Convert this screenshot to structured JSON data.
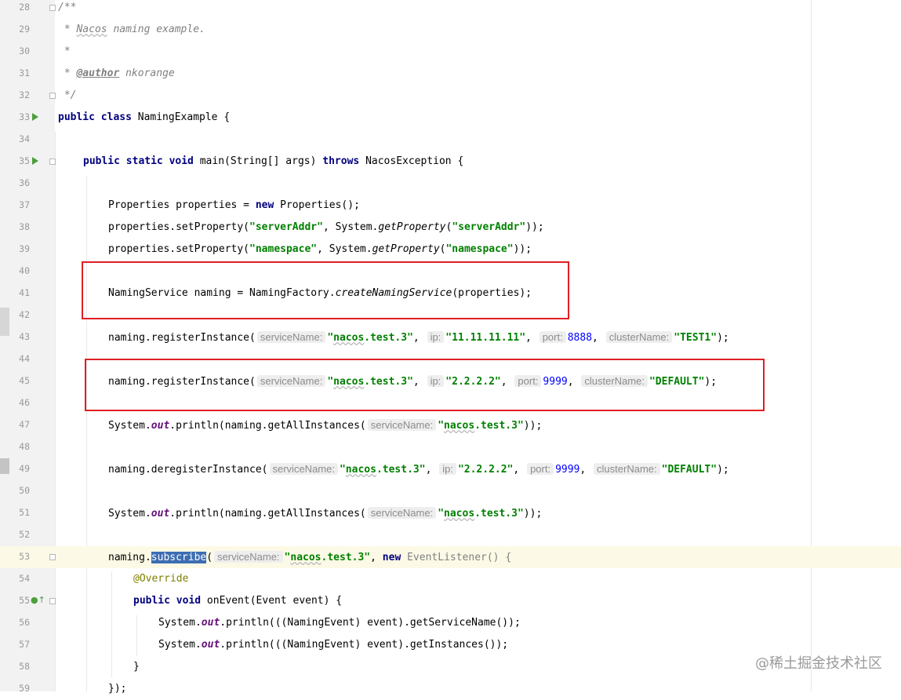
{
  "editor": {
    "lines": {
      "l28": {
        "ln": "28",
        "c": "/**"
      },
      "l29": {
        "ln": "29",
        "a": " * ",
        "b": "Nacos",
        "c": " naming example."
      },
      "l30": {
        "ln": "30",
        "c": " *"
      },
      "l31": {
        "ln": "31",
        "a": " * ",
        "b": "@author",
        "c": " nkorange"
      },
      "l32": {
        "ln": "32",
        "c": " */"
      },
      "l33": {
        "ln": "33",
        "a": "public class ",
        "b": "NamingExample {"
      },
      "l34": {
        "ln": "34"
      },
      "l35": {
        "ln": "35",
        "a": "public static void ",
        "b": "main(String[] args) ",
        "c": "throws ",
        "d": "NacosException {"
      },
      "l36": {
        "ln": "36"
      },
      "l37": {
        "ln": "37",
        "a": "Properties properties = ",
        "b": "new ",
        "c": "Properties();"
      },
      "l38": {
        "ln": "38",
        "a": "properties.setProperty(",
        "b": "\"serverAddr\"",
        "c": ", System.",
        "d": "getProperty",
        "e": "(",
        "f": "\"serverAddr\"",
        "g": "));"
      },
      "l39": {
        "ln": "39",
        "a": "properties.setProperty(",
        "b": "\"namespace\"",
        "c": ", System.",
        "d": "getProperty",
        "e": "(",
        "f": "\"namespace\"",
        "g": "));"
      },
      "l40": {
        "ln": "40"
      },
      "l41": {
        "ln": "41",
        "a": "NamingService naming = NamingFactory.",
        "b": "createNamingService",
        "c": "(properties);"
      },
      "l42": {
        "ln": "42"
      },
      "l43": {
        "ln": "43",
        "a": "naming.registerInstance(",
        "h1": "serviceName:",
        "s1a": "\"",
        "s1b": "nacos",
        "s1c": ".test.3\"",
        ",1": ",",
        "h2": "ip:",
        "s2": "\"11.11.11.11\"",
        ",2": ",",
        "h3": "port:",
        "n3": "8888",
        ",3": ",",
        "h4": "clusterName:",
        "s4": "\"TEST1\"",
        "e": ");"
      },
      "l44": {
        "ln": "44"
      },
      "l45": {
        "ln": "45",
        "a": "naming.registerInstance(",
        "h1": "serviceName:",
        "s1a": "\"",
        "s1b": "nacos",
        "s1c": ".test.3\"",
        ",1": ",",
        "h2": "ip:",
        "s2": "\"2.2.2.2\"",
        ",2": ",",
        "h3": "port:",
        "n3": "9999",
        ",3": ",",
        "h4": "clusterName:",
        "s4": "\"DEFAULT\"",
        "e": ");"
      },
      "l46": {
        "ln": "46"
      },
      "l47": {
        "ln": "47",
        "a": "System.",
        "f": "out",
        "b": ".println(naming.getAllInstances(",
        "h1": "serviceName:",
        "s1a": "\"",
        "s1b": "nacos",
        "s1c": ".test.3\"",
        "e": "));"
      },
      "l48": {
        "ln": "48"
      },
      "l49": {
        "ln": "49",
        "a": "naming.deregisterInstance(",
        "h1": "serviceName:",
        "s1a": "\"",
        "s1b": "nacos",
        "s1c": ".test.3\"",
        ",1": ",",
        "h2": "ip:",
        "s2": "\"2.2.2.2\"",
        ",2": ",",
        "h3": "port:",
        "n3": "9999",
        ",3": ",",
        "h4": "clusterName:",
        "s4": "\"DEFAULT\"",
        "e": ");"
      },
      "l50": {
        "ln": "50"
      },
      "l51": {
        "ln": "51",
        "a": "System.",
        "f": "out",
        "b": ".println(naming.getAllInstances(",
        "h1": "serviceName:",
        "s1a": "\"",
        "s1b": "nacos",
        "s1c": ".test.3\"",
        "e": "));"
      },
      "l52": {
        "ln": "52"
      },
      "l53": {
        "ln": "53",
        "a": "naming.",
        "sel": "subscribe",
        "b": "(",
        "h1": "serviceName:",
        "s1a": "\"",
        "s1b": "nacos",
        "s1c": ".test.3\"",
        "c": ", ",
        "kw": "new ",
        "g": "EventListener() {"
      },
      "l54": {
        "ln": "54",
        "an": "@Override"
      },
      "l55": {
        "ln": "55",
        "a": "public void ",
        "b": "onEvent(Event event) {"
      },
      "l56": {
        "ln": "56",
        "a": "System.",
        "f": "out",
        "b": ".println(((NamingEvent) event).getServiceName());"
      },
      "l57": {
        "ln": "57",
        "a": "System.",
        "f": "out",
        "b": ".println(((NamingEvent) event).getInstances());"
      },
      "l58": {
        "ln": "58",
        "a": "}"
      },
      "l59": {
        "ln": "59",
        "a": "});"
      }
    }
  },
  "watermark": "@稀土掘金技术社区",
  "colors": {
    "highlight_box": "#e11f24",
    "current_line": "#fcfae6",
    "selection": "#3d6db3"
  }
}
